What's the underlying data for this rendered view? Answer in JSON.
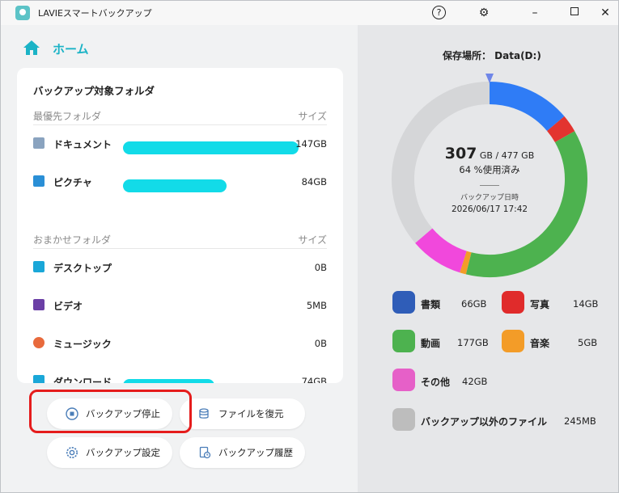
{
  "app": {
    "title": "LAVIEスマートバックアップ"
  },
  "titlebar": {
    "help": "?",
    "settings": "⚙",
    "minimize": "–",
    "close": "✕"
  },
  "nav": {
    "home_label": "ホーム"
  },
  "card": {
    "title": "バックアップ対象フォルダ",
    "priority": {
      "header": "最優先フォルダ",
      "size_header": "サイズ",
      "items": [
        {
          "name": "ドキュメント",
          "size": "147GB",
          "fill": 1.0,
          "icon": "document-icon",
          "color": "#6f8fb0"
        },
        {
          "name": "ピクチャ",
          "size": "84GB",
          "fill": 0.59,
          "icon": "picture-icon",
          "color": "#2a8fd6"
        }
      ]
    },
    "auto": {
      "header": "おまかせフォルダ",
      "size_header": "サイズ",
      "items": [
        {
          "name": "デスクトップ",
          "size": "0B",
          "fill": 0,
          "icon": "desktop-icon",
          "color": "#1aa7d8"
        },
        {
          "name": "ビデオ",
          "size": "5MB",
          "fill": 0,
          "icon": "video-icon",
          "color": "#6b3fa6"
        },
        {
          "name": "ミュージック",
          "size": "0B",
          "fill": 0,
          "icon": "music-icon",
          "color": "#e86a3c"
        },
        {
          "name": "ダウンロード",
          "size": "74GB",
          "fill": 0.52,
          "icon": "download-icon",
          "color": "#1aa7d8"
        }
      ]
    }
  },
  "buttons": {
    "stop_backup": "バックアップ停止",
    "restore": "ファイルを復元",
    "settings": "バックアップ設定",
    "history": "バックアップ履歴"
  },
  "storage": {
    "location_label": "保存場所： Data(D:)",
    "used_value": "307",
    "used_rest": " GB / 477 GB",
    "percent_text": "64 %使用済み",
    "backup_label": "バックアップ日時",
    "backup_datetime": "2026/06/17 17:42"
  },
  "chart_data": {
    "type": "pie",
    "title": "",
    "total": 477,
    "series": [
      {
        "name": "書類",
        "value": 66,
        "color": "#2f7cf6"
      },
      {
        "name": "写真",
        "value": 14,
        "color": "#e3342f"
      },
      {
        "name": "動画",
        "value": 177,
        "color": "#4db24f"
      },
      {
        "name": "音楽",
        "value": 5,
        "color": "#f39c28"
      },
      {
        "name": "その他",
        "value": 42,
        "color": "#f148dc"
      },
      {
        "name": "空き",
        "value": 173,
        "color": "#d5d6d8"
      }
    ]
  },
  "legend": [
    {
      "name": "書類",
      "size": "66GB",
      "icon": "document-icon",
      "color": "#2f5db8"
    },
    {
      "name": "写真",
      "size": "14GB",
      "icon": "photo-icon",
      "color": "#e02b2b"
    },
    {
      "name": "動画",
      "size": "177GB",
      "icon": "video-icon",
      "color": "#4db24f"
    },
    {
      "name": "音楽",
      "size": "5GB",
      "icon": "music-icon",
      "color": "#f39c28"
    },
    {
      "name": "その他",
      "size": "42GB",
      "icon": "folder-icon",
      "color": "#e660c8"
    },
    {
      "name": "バックアップ以外のファイル",
      "size": "245MB",
      "icon": "folder-icon",
      "color": "#bdbdbd"
    }
  ]
}
